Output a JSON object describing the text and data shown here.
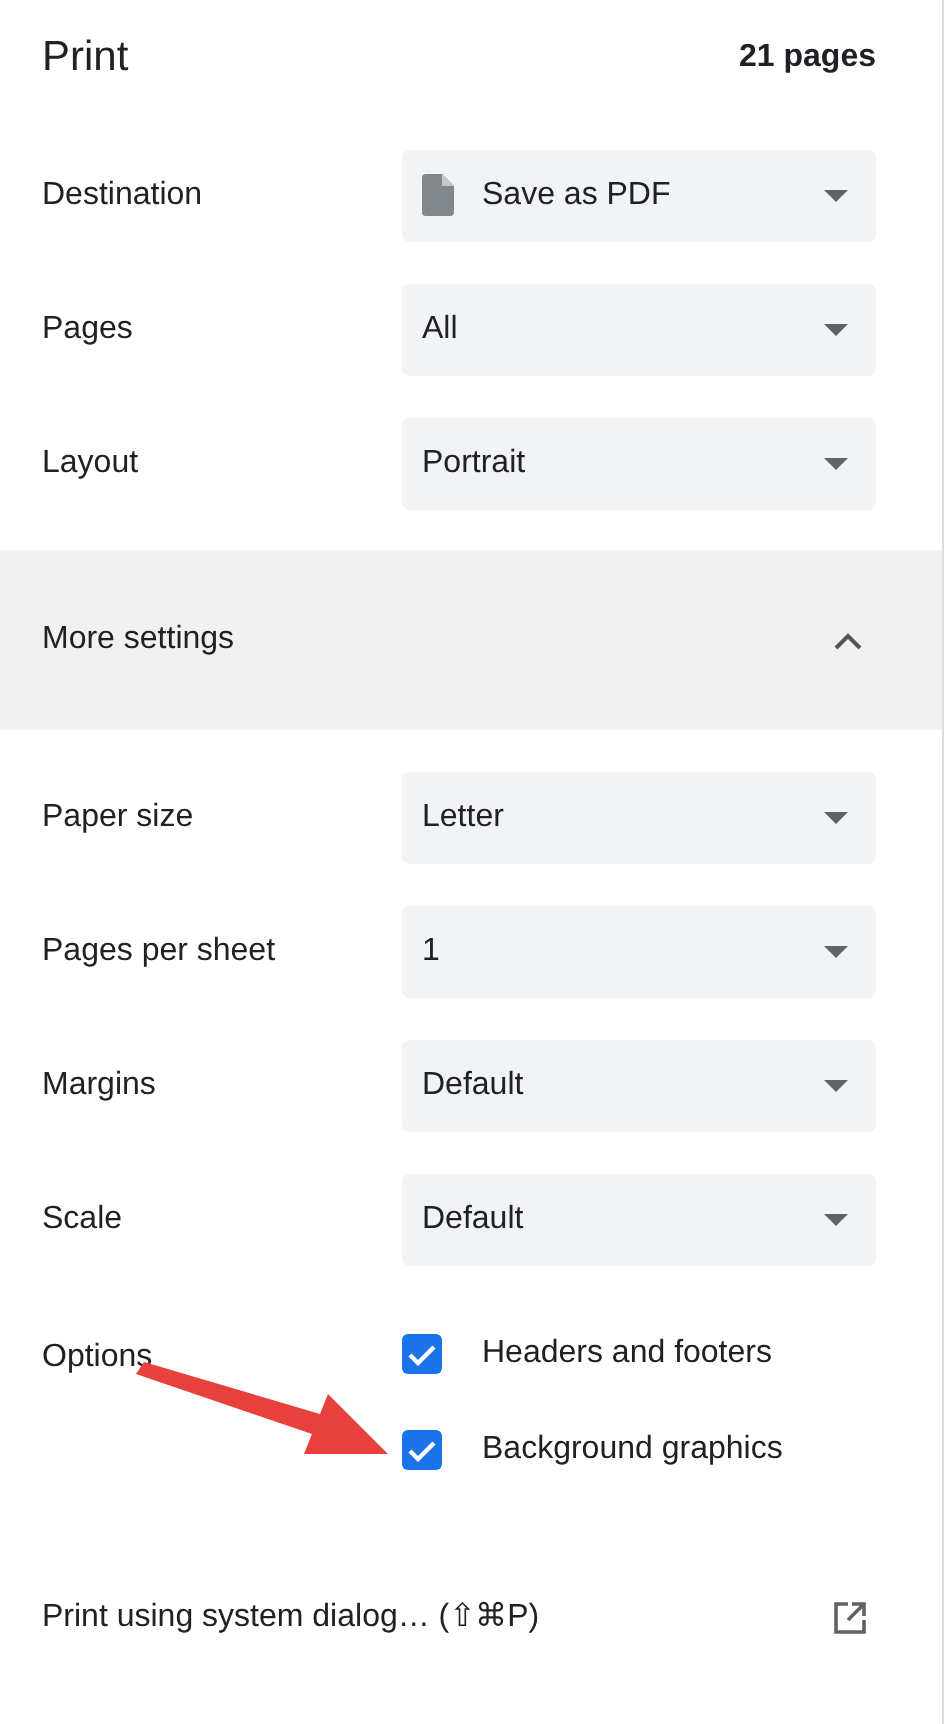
{
  "header": {
    "title": "Print",
    "page_count": "21 pages"
  },
  "main_settings": [
    {
      "label": "Destination",
      "value": "Save as PDF",
      "kind": "file"
    },
    {
      "label": "Pages",
      "value": "All",
      "kind": "plain"
    },
    {
      "label": "Layout",
      "value": "Portrait",
      "kind": "plain"
    }
  ],
  "more_settings": {
    "label": "More settings",
    "expanded": true
  },
  "extra_settings": [
    {
      "label": "Paper size",
      "value": "Letter"
    },
    {
      "label": "Pages per sheet",
      "value": "1"
    },
    {
      "label": "Margins",
      "value": "Default"
    },
    {
      "label": "Scale",
      "value": "Default"
    }
  ],
  "options": {
    "label": "Options",
    "items": [
      {
        "label": "Headers and footers",
        "checked": true
      },
      {
        "label": "Background graphics",
        "checked": true
      }
    ]
  },
  "system_dialog": {
    "label": "Print using system dialog… (⇧⌘P)"
  }
}
